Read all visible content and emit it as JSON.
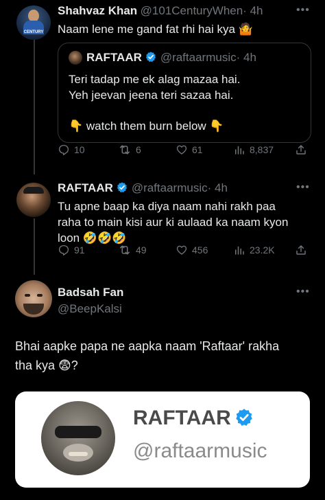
{
  "tweet1": {
    "name": "Shahvaz Khan",
    "handle": "@101CenturyWhen",
    "time": "· 4h",
    "text": "Naam lene me gand fat rhi hai kya 🤷",
    "avatar_text": "CENTURY",
    "quote": {
      "name": "RAFTAAR",
      "handle": "@raftaarmusic",
      "time": "· 4h",
      "line1": "Teri tadap me ek alag mazaa hai.",
      "line2": "Yeh jeevan jeena teri sazaa hai.",
      "line3": "👇 watch them burn below 👇"
    },
    "replies": "10",
    "retweets": "6",
    "likes": "61",
    "views": "8,837"
  },
  "tweet2": {
    "name": "RAFTAAR",
    "handle": "@raftaarmusic",
    "time": "· 4h",
    "line1": "Tu apne baap ka diya naam nahi rakh paa",
    "line2": "raha to main kisi aur ki aulaad ka naam kyon",
    "line3": "loon 🤣🤣🤣",
    "replies": "91",
    "retweets": "49",
    "likes": "456",
    "views": "23.2K"
  },
  "tweet3": {
    "name": "Badsah Fan",
    "handle": "@BeepKalsi",
    "line1": "Bhai aapke papa ne aapka naam 'Raftaar' rakha",
    "line2": "tha kya 😨?"
  },
  "profile_card": {
    "name": "RAFTAAR",
    "handle": "@raftaarmusic"
  },
  "colors": {
    "background": "#000000",
    "verified": "#1d9bf0",
    "muted": "#71767b",
    "text": "#e7e9ea"
  },
  "icons": [
    "reply-icon",
    "retweet-icon",
    "like-icon",
    "views-icon",
    "share-icon",
    "verified-icon",
    "more-icon"
  ]
}
